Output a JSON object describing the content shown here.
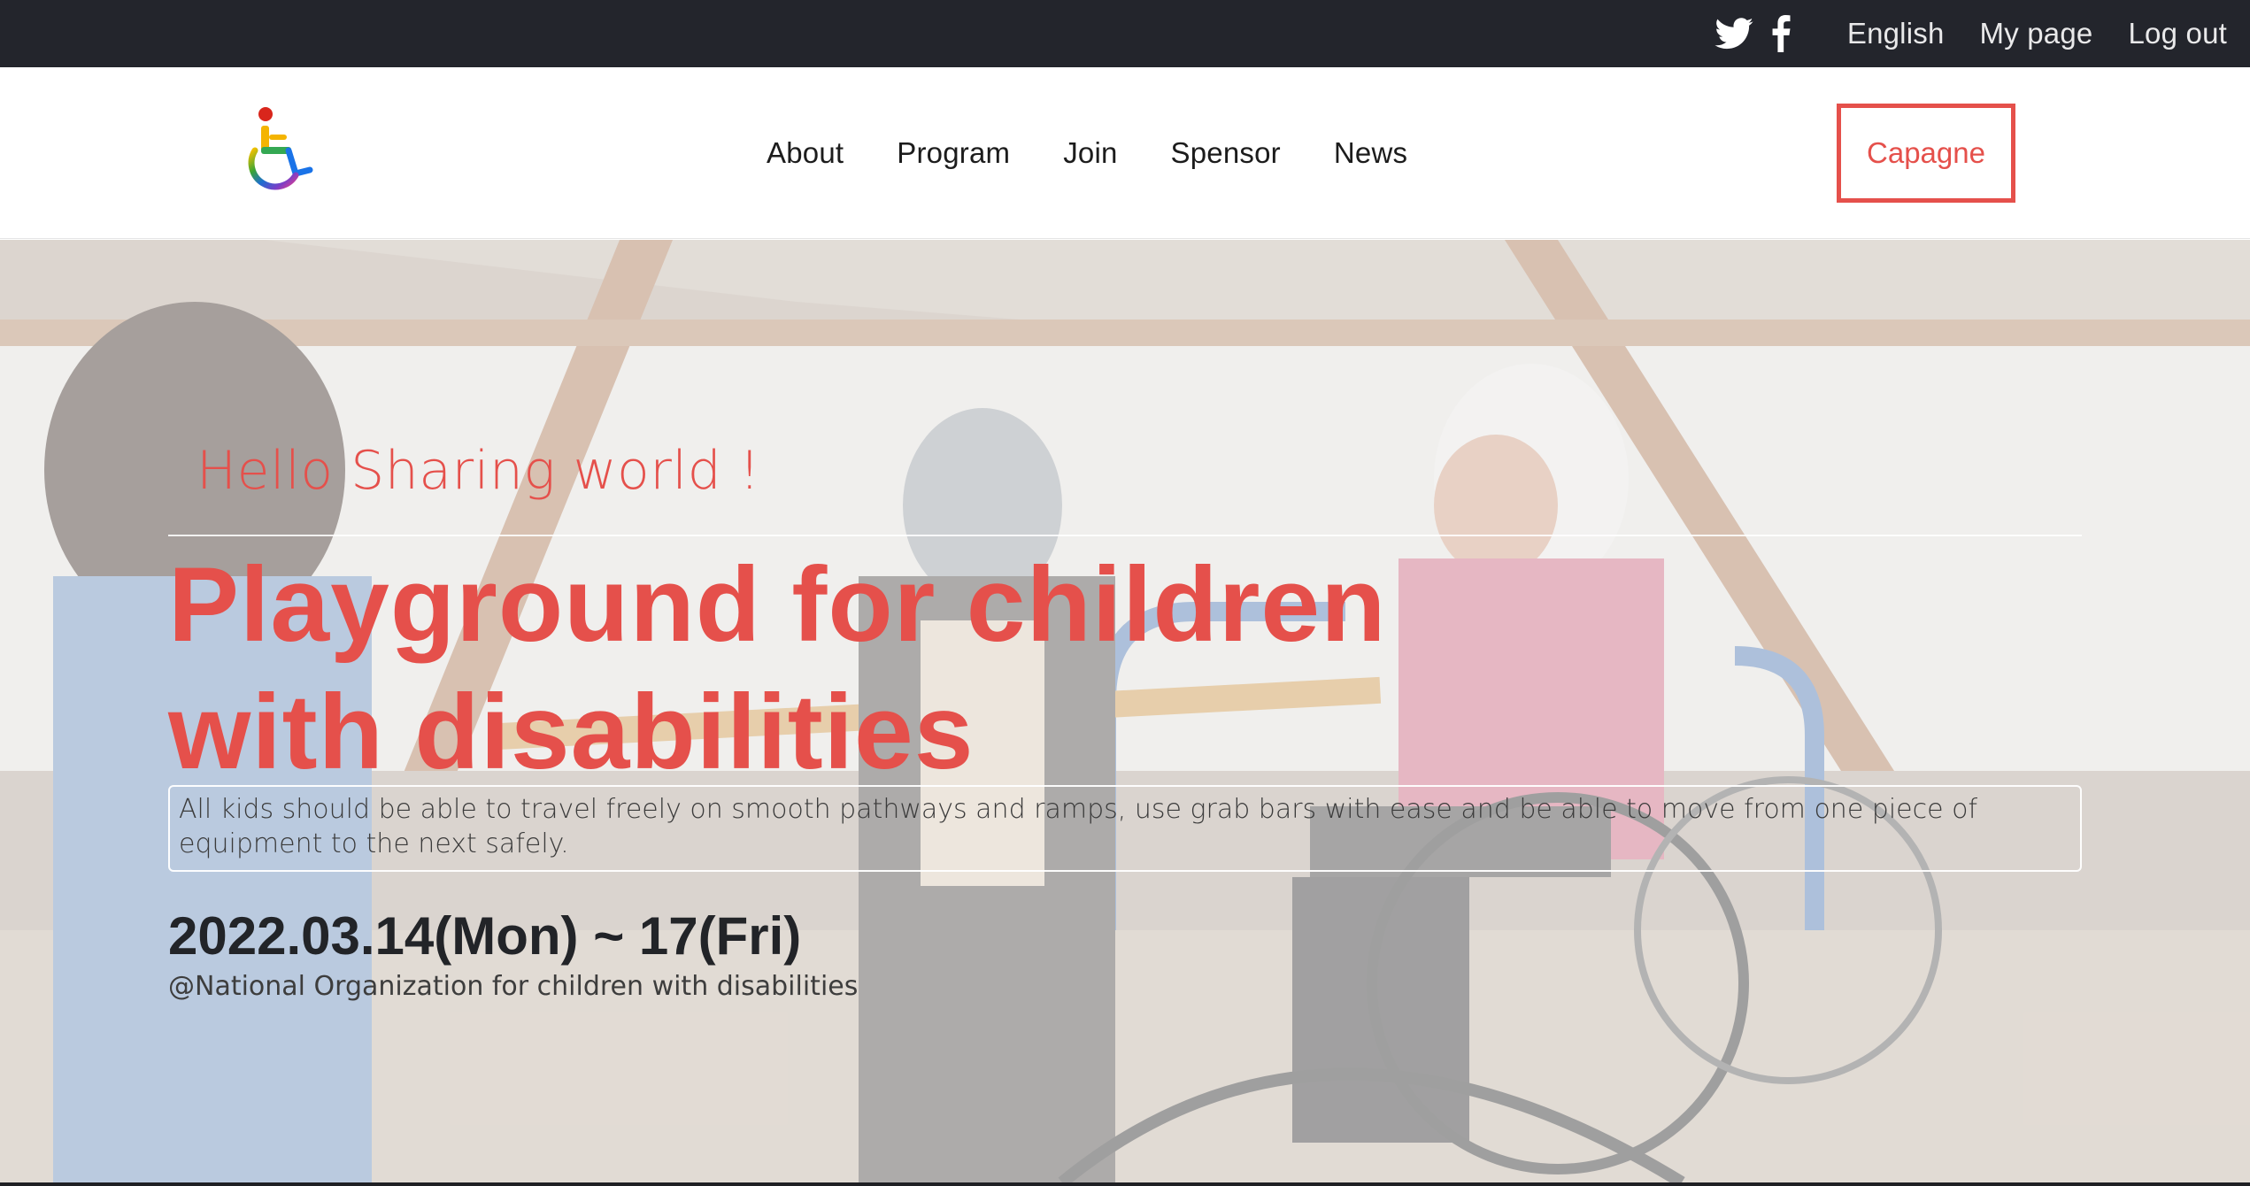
{
  "topbar": {
    "social": [
      {
        "icon": "twitter-icon",
        "label": "Twitter"
      },
      {
        "icon": "facebook-icon",
        "label": "Facebook"
      }
    ],
    "links": {
      "language": "English",
      "my_page": "My page",
      "logout": "Log out"
    }
  },
  "header": {
    "logo_icon": "wheelchair-logo-icon",
    "nav": [
      {
        "label": "About"
      },
      {
        "label": "Program"
      },
      {
        "label": "Join"
      },
      {
        "label": "Spensor"
      },
      {
        "label": "News"
      }
    ],
    "cta_label": "Capagne"
  },
  "hero": {
    "greeting": "Hello Sharing world !",
    "headline_line1": "Playground for children",
    "headline_line2": "with disabilities",
    "description": "All kids should be able to travel freely on smooth pathways and ramps, use grab bars with ease and be able to move from one piece of equipment to the next safely.",
    "date": "2022.03.14(Mon) ~ 17(Fri)",
    "venue": "@National Organization for children with disabilities"
  },
  "colors": {
    "accent": "#e5504b",
    "topbar_bg": "#23252c",
    "text_dark": "#222428"
  }
}
